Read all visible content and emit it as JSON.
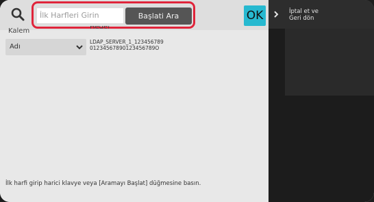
{
  "search": {
    "placeholder": "İlk Harfleri Girin",
    "start_label": "Başlati Ara",
    "ok_label": "OK"
  },
  "columns": {
    "kalem_label": "Kalem",
    "hedef_label": "Hedef"
  },
  "item_select": {
    "selected": "Adı"
  },
  "target": {
    "line1": "LDAP_SERVER_1_123456789",
    "line2": "01234567890123456789O"
  },
  "hint_text": "İlk harfi girip harici klavye veya [Aramayı Başlat] düğmesine basın.",
  "side": {
    "line1": "İptal et ve",
    "line2": "Geri dön"
  },
  "colors": {
    "highlight": "#e0243a",
    "ok_button": "#27b9d0"
  }
}
